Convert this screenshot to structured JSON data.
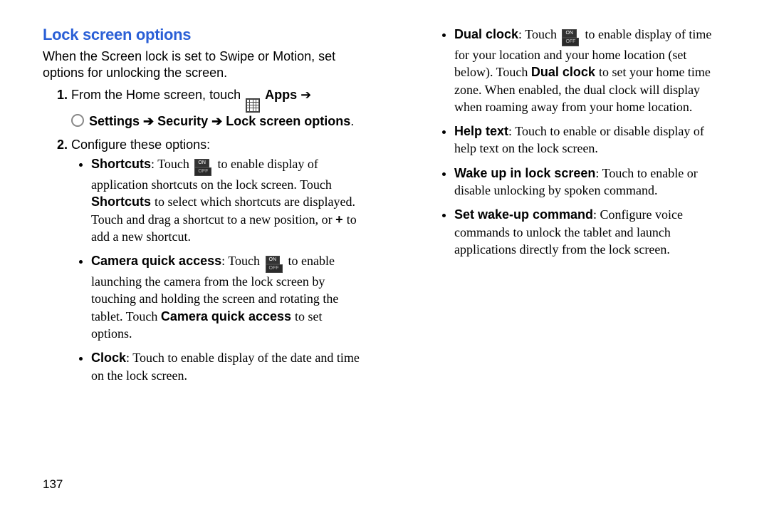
{
  "title": "Lock screen options",
  "intro": "When the Screen lock is set to Swipe or Motion, set options for unlocking the screen.",
  "page_number": "137",
  "step1": {
    "prefix": "From the Home screen, touch ",
    "apps": "Apps",
    "path": "Settings ➔ Security ➔ Lock screen options"
  },
  "step2": {
    "prefix": "Configure these options:"
  },
  "bullets": {
    "shortcuts": {
      "lead": "Shortcuts",
      "g1": ": Touch ",
      "g2": " to enable display of application shortcuts on the lock screen. Touch ",
      "mid": "Shortcuts",
      "g3": " to select which shortcuts are displayed. Touch and drag a shortcut to a new position, or ",
      "plus": "+",
      "g4": " to add a new shortcut."
    },
    "camera": {
      "lead": "Camera quick access",
      "g1": ": Touch ",
      "g2": " to enable launching the camera from the lock screen by touching and holding the screen and rotating the tablet. Touch ",
      "mid": "Camera quick access",
      "g3": " to set options."
    },
    "clock": {
      "lead": "Clock",
      "g1": ": Touch to enable display of the date and time on the lock screen."
    },
    "dual": {
      "lead": "Dual clock",
      "g1": ": Touch ",
      "g2": " to enable display of time for your location and your home location (set below). Touch ",
      "mid": "Dual clock",
      "g3": " to set your home time zone. When enabled, the dual clock will display when roaming away from your home location."
    },
    "help": {
      "lead": "Help text",
      "g1": ": Touch to enable or disable display of help text on the lock screen."
    },
    "wake": {
      "lead": "Wake up in lock screen",
      "g1": ": Touch to enable or disable unlocking by spoken command."
    },
    "cmd": {
      "lead": "Set wake-up command",
      "g1": ": Configure voice commands to unlock the tablet and launch applications directly from the lock screen."
    }
  },
  "toggle_labels": {
    "on": "ON",
    "off": "OFF"
  }
}
